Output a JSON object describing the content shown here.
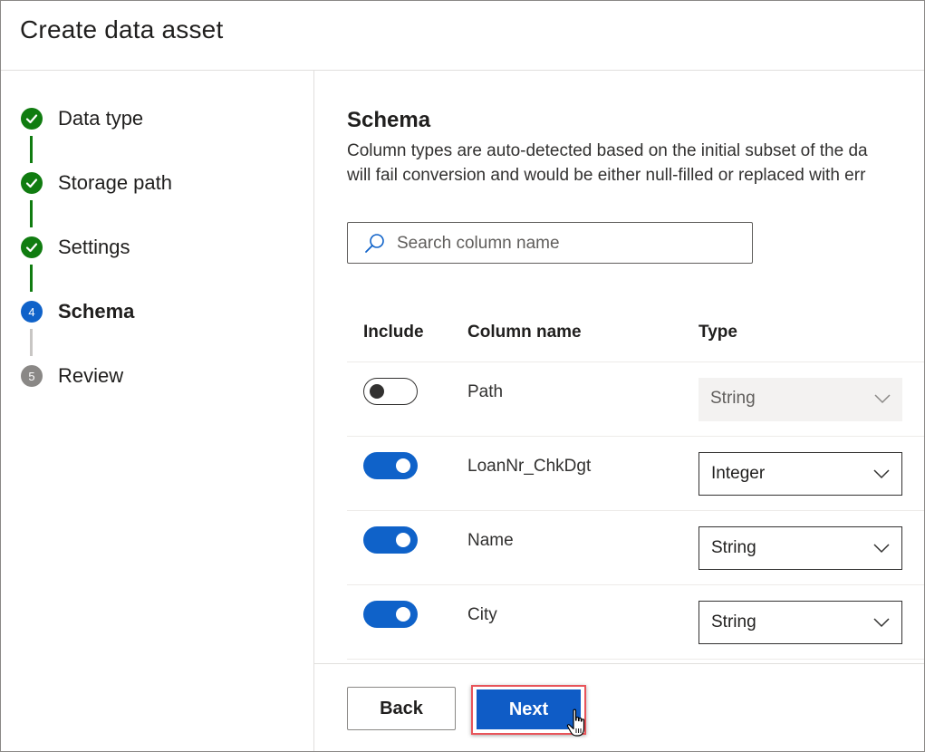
{
  "dialog": {
    "title": "Create data asset"
  },
  "steps": [
    {
      "label": "Data type",
      "state": "done"
    },
    {
      "label": "Storage path",
      "state": "done"
    },
    {
      "label": "Settings",
      "state": "done"
    },
    {
      "number": "4",
      "label": "Schema",
      "state": "current"
    },
    {
      "number": "5",
      "label": "Review",
      "state": "pending"
    }
  ],
  "schema": {
    "title": "Schema",
    "description_line1": "Column types are auto-detected based on the initial subset of the da",
    "description_line2": "will fail conversion and would be either null-filled or replaced with err",
    "search": {
      "placeholder": "Search column name"
    },
    "headers": {
      "include": "Include",
      "column_name": "Column name",
      "type": "Type"
    },
    "rows": [
      {
        "include": false,
        "name": "Path",
        "type": "String",
        "type_enabled": false
      },
      {
        "include": true,
        "name": "LoanNr_ChkDgt",
        "type": "Integer",
        "type_enabled": true
      },
      {
        "include": true,
        "name": "Name",
        "type": "String",
        "type_enabled": true
      },
      {
        "include": true,
        "name": "City",
        "type": "String",
        "type_enabled": true
      }
    ]
  },
  "footer": {
    "back_label": "Back",
    "next_label": "Next"
  },
  "colors": {
    "done": "#107c10",
    "current": "#0f62c9",
    "primary": "#0f5cc6",
    "highlight": "#e8545a"
  }
}
